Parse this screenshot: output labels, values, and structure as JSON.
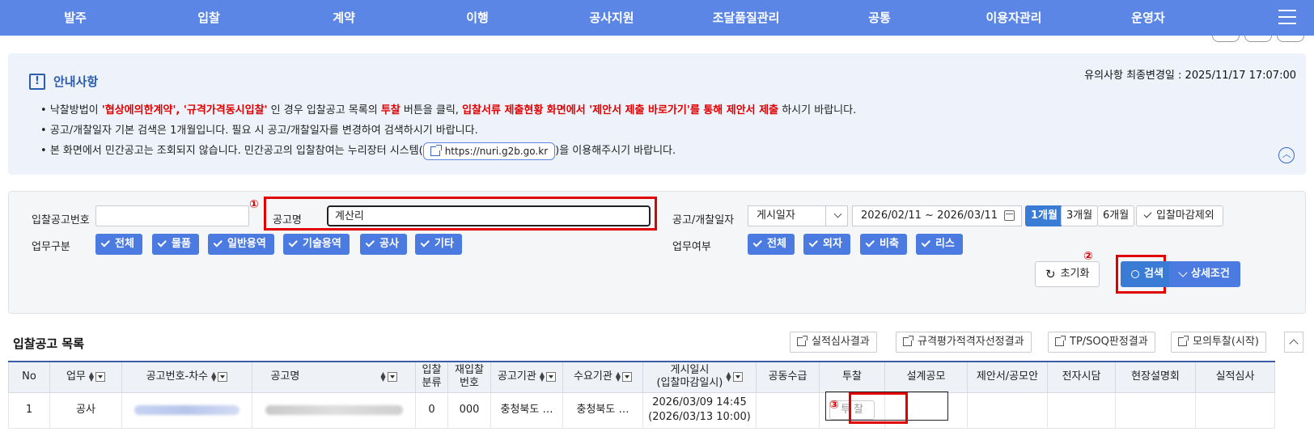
{
  "nav": {
    "items": [
      "발주",
      "입찰",
      "계약",
      "이행",
      "공사지원",
      "조달품질관리",
      "공통",
      "이용자관리",
      "운영자"
    ]
  },
  "notice": {
    "title": "안내사항",
    "updated": "유의사항 최종변경일 : 2025/11/17 17:07:00",
    "line1_a": "낙찰방법이 ",
    "line1_b": "'협상에의한계약', '규격가격동시입찰'",
    "line1_c": " 인 경우 입찰공고 목록의 ",
    "line1_d": "투찰",
    "line1_e": " 버튼을 클릭, ",
    "line1_f": "입찰서류 제출현황 화면에서 '제안서 제출 바로가기'를 통해 제안서 제출",
    "line1_g": " 하시기 바랍니다.",
    "line2": "공고/개찰일자 기본 검색은 1개월입니다. 필요 시 공고/개찰일자를 변경하여 검색하시기 바랍니다.",
    "line3_a": "본 화면에서 민간공고는 조회되지 않습니다. 민간공고의 입찰참여는 누리장터 시스템(",
    "line3_link": "https://nuri.g2b.go.kr",
    "line3_b": ")을 이용해주시기 바랍니다."
  },
  "search": {
    "bid_no_label": "입찰공고번호",
    "bid_no_value": "",
    "name_label": "공고명",
    "name_value": "계산리",
    "date_label": "공고/개찰일자",
    "date_type": "게시일자",
    "date_range": "2026/02/11  ~  2026/03/11",
    "periods": [
      "1개월",
      "3개월",
      "6개월"
    ],
    "exclude_closed": "입찰마감제외",
    "biz_label": "업무구분",
    "biz_options": [
      "전체",
      "물품",
      "일반용역",
      "기술용역",
      "공사",
      "기타"
    ],
    "work_label": "업무여부",
    "work_options": [
      "전체",
      "외자",
      "비축",
      "리스"
    ],
    "reset": "초기화",
    "search": "검색",
    "detail": "상세조건",
    "marker1": "①",
    "marker2": "②",
    "marker3": "③"
  },
  "list": {
    "title": "입찰공고 목록",
    "buttons": [
      "실적심사결과",
      "규격평가적격자선정결과",
      "TP/SOQ판정결과",
      "모의투찰(시작)"
    ]
  },
  "table": {
    "headers": [
      "No",
      "업무",
      "공고번호-차수",
      "공고명",
      "입찰\n분류",
      "재입찰\n번호",
      "공고기관",
      "수요기관",
      "게시일시\n(입찰마감일시)",
      "공동수급",
      "투찰",
      "설계공모",
      "제안서/공모안",
      "전자시담",
      "현장설명회",
      "실적심사"
    ],
    "rows": [
      {
        "no": "1",
        "type": "공사",
        "category": "0",
        "rebid": "000",
        "agency": "충청북도 …",
        "demand": "충청북도 …",
        "posted": "2026/03/09 14:45",
        "deadline": "(2026/03/13 10:00)",
        "bid_label": "투 찰"
      }
    ]
  },
  "colors": {
    "nav": "#5b86e5",
    "accent": "#3a7bd5",
    "highlight": "#e00000"
  }
}
